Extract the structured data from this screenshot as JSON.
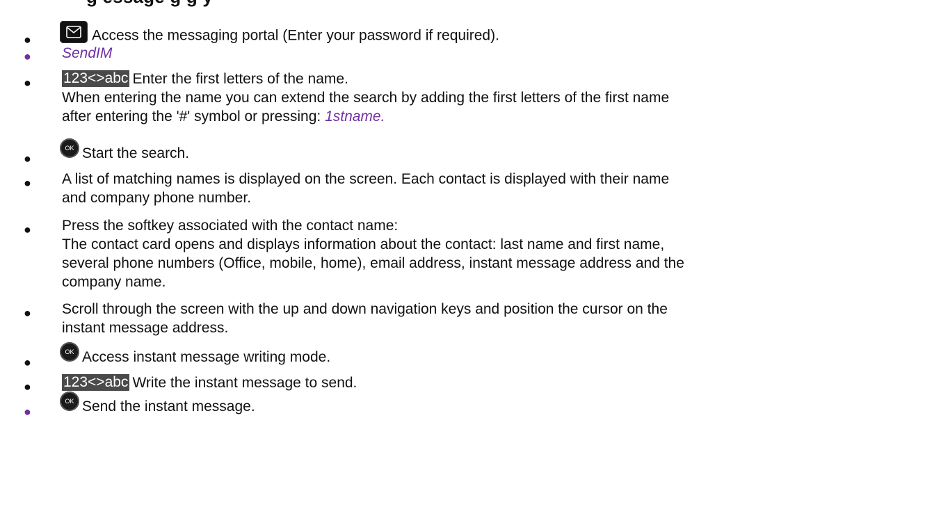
{
  "heading": "g      essage  g  g     y",
  "icons": {
    "mail_key": "envelope-key-icon",
    "ok_key": "ok-key-icon"
  },
  "colors": {
    "bullet": "#111111",
    "accent_purple": "#7030a0",
    "badge_bg": "#4a4a4a"
  },
  "steps": [
    {
      "text": "Access the messaging portal (Enter your password if required)."
    },
    {
      "label": "SendIM"
    },
    {
      "badge": "123<>abc",
      "text": "Enter the first letters of the name.",
      "sub1": "When entering the name you can extend the search by adding the first letters of the first name",
      "sub2": "after entering the '#' symbol or pressing:",
      "sub2_label": "1stname."
    },
    {
      "ok": "OK",
      "text": "Start the search."
    },
    {
      "text1": "A list of matching names is displayed on the screen. Each contact is displayed with their name",
      "text2": "and company phone number."
    },
    {
      "text1": "Press the softkey associated with the contact name:",
      "text2": "The contact card opens and displays information about the contact: last name and first name,",
      "text3": "several phone numbers (Office, mobile, home), email address, instant message address and the",
      "text4": "company name."
    },
    {
      "text1": "Scroll through the screen with the up and down navigation keys and position the cursor on the",
      "text2": "instant message address."
    },
    {
      "ok": "OK",
      "text": "Access instant message writing mode."
    },
    {
      "badge": "123<>abc",
      "text": "Write the instant message to send."
    },
    {
      "ok": "OK",
      "text": "Send the instant message."
    }
  ]
}
